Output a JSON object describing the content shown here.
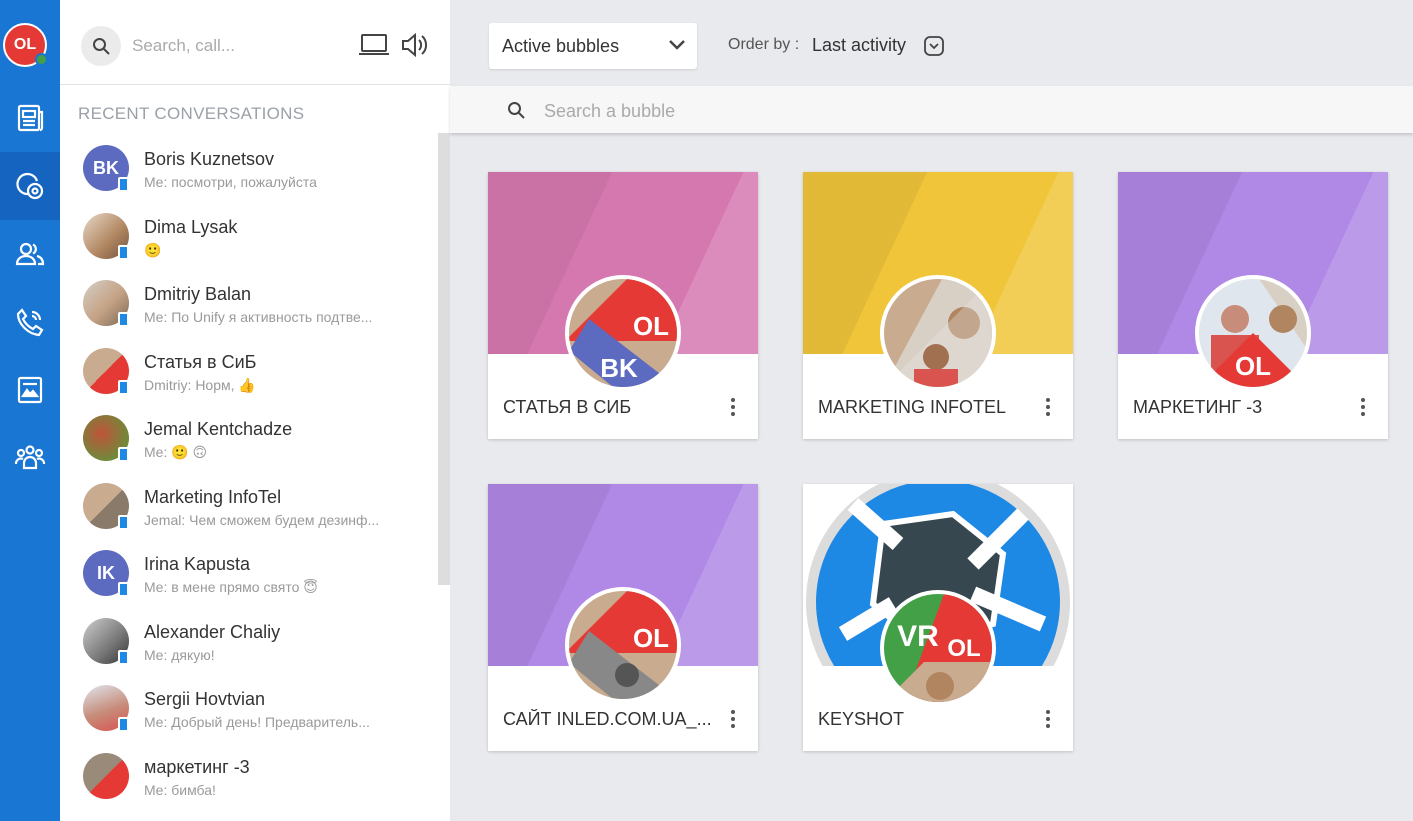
{
  "user": {
    "initials": "OL",
    "status_color": "#43a047"
  },
  "rail": {
    "items": [
      {
        "icon": "news-icon"
      },
      {
        "icon": "bubbles-icon",
        "active": true
      },
      {
        "icon": "contacts-icon"
      },
      {
        "icon": "calls-icon"
      },
      {
        "icon": "files-icon"
      },
      {
        "icon": "companies-icon"
      }
    ]
  },
  "search": {
    "placeholder": "Search, call..."
  },
  "recent": {
    "title": "RECENT CONVERSATIONS",
    "items": [
      {
        "name": "Boris Kuznetsov",
        "message": "Me: посмотри, пожалуйста",
        "initials": "BK",
        "color": "#5c6bc0"
      },
      {
        "name": "Dima Lysak",
        "message": "🙂",
        "initials": "",
        "color": "#b0855f"
      },
      {
        "name": "Dmitriy Balan",
        "message": "Me: По Unify я активность подтве...",
        "initials": "",
        "color": "#c4a284"
      },
      {
        "name": "Статья в СиБ",
        "message": "Dmitriy: Норм, 👍",
        "initials": "",
        "color": "#b8a08a"
      },
      {
        "name": "Jemal Kentchadze",
        "message": "Me: 🙂 🙃",
        "initials": "",
        "color": "#8d6e4f"
      },
      {
        "name": "Marketing InfoTel",
        "message": "Jemal: Чем сможем будем дезинф...",
        "initials": "",
        "color": "#a89078"
      },
      {
        "name": "Irina Kapusta",
        "message": "Me: в мене прямо свято 😇",
        "initials": "IK",
        "color": "#5c6bc0"
      },
      {
        "name": "Alexander Chaliy",
        "message": "Me: дякую!",
        "initials": "",
        "color": "#777777"
      },
      {
        "name": "Sergii Hovtvian",
        "message": "Me: Добрый день! Предваритель...",
        "initials": "",
        "color": "#c78c7a"
      },
      {
        "name": "маркетинг -3",
        "message": "Me: бимба!",
        "initials": "",
        "color": "#9a8a7a"
      }
    ]
  },
  "filter": {
    "label": "Active bubbles"
  },
  "order": {
    "label": "Order by :",
    "value": "Last activity"
  },
  "bubble_search": {
    "placeholder": "Search a bubble"
  },
  "bubbles": [
    {
      "title": "СТАТЬЯ В СИБ",
      "color": "#d678b0",
      "tag1": "OL",
      "tag2": "BK"
    },
    {
      "title": "MARKETING INFOTEL",
      "color": "#f0c53a",
      "tag1": "",
      "tag2": ""
    },
    {
      "title": "МАРКЕТИНГ -3",
      "color": "#b088e6",
      "tag1": "",
      "tag2": "OL"
    },
    {
      "title": "САЙТ INLED.COM.UA_...",
      "color": "#b088e6",
      "tag1": "OL",
      "tag2": ""
    },
    {
      "title": "KEYSHOT",
      "color": "#ffffff",
      "tag1": "VR",
      "tag2": "OL"
    }
  ]
}
